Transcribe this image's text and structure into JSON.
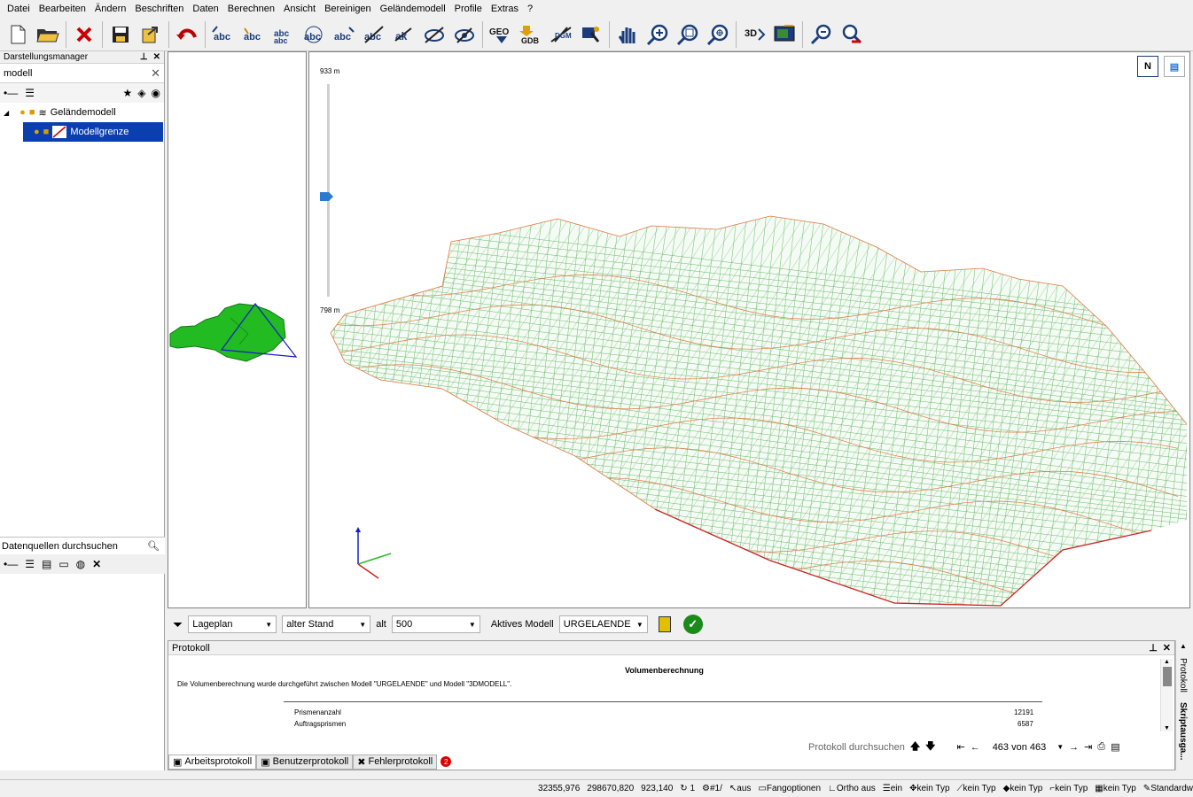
{
  "menu": [
    "Datei",
    "Bearbeiten",
    "Ändern",
    "Beschriften",
    "Daten",
    "Berechnen",
    "Ansicht",
    "Bereinigen",
    "Geländemodell",
    "Profile",
    "Extras",
    "?"
  ],
  "toolbar": {
    "icons": [
      "new-file-icon",
      "open-folder-icon",
      "close-icon",
      "save-icon",
      "export-icon",
      "undo-icon",
      "label-abc-icon",
      "label-abc-edit-icon",
      "label-abc-move-icon",
      "label-abc-rotate-icon",
      "label-abc-copy-icon",
      "label-abc-delete-icon",
      "label-ak-icon",
      "label-hide-icon",
      "label-show-icon",
      "geo-icon",
      "gdb-icon",
      "dgm-icon",
      "user-icon",
      "hand-pan-icon",
      "zoom-in-icon",
      "zoom-window-icon",
      "zoom-extent-icon",
      "view-3d-icon",
      "display-icon",
      "pick-icon",
      "search-erase-icon"
    ],
    "labels": {
      "geo": "GEO",
      "gdb": "GDB",
      "threed": "3D"
    }
  },
  "left_panel": {
    "title": "Darstellungsmanager",
    "search_value": "modell",
    "tree": {
      "root": "Geländemodell",
      "child": "Modellgrenze"
    }
  },
  "sources_panel": {
    "title": "Datenquellen durchsuchen"
  },
  "view3d": {
    "scale_top": "933 m",
    "scale_bottom": "798 m",
    "north_label": "N"
  },
  "filterbar": {
    "view_value": "Lageplan",
    "state_value": "alter Stand",
    "alt_label": "alt",
    "scale_value": "500",
    "active_model_label": "Aktives Modell",
    "active_model_value": "URGELAENDE"
  },
  "protokoll": {
    "title": "Protokoll",
    "heading": "Volumenberechnung",
    "text": "Die Volumenberechnung wurde durchgeführt zwischen Modell \"URGELAENDE\" und Modell \"3DMODELL\".",
    "rows": [
      {
        "label": "Prismenanzahl",
        "value": "12191"
      },
      {
        "label": "Auftragsprismen",
        "value": "6587"
      }
    ],
    "search_label": "Protokoll durchsuchen",
    "page_value": "463 von 463",
    "tabs": [
      "Arbeitsprotokoll",
      "Benutzerprotokoll",
      "Fehlerprotokoll"
    ],
    "error_badge": "2",
    "side_tabs": [
      "Protokoll",
      "Skriptausga..."
    ]
  },
  "status": {
    "coord_x": "32355,976",
    "coord_y": "298670,820",
    "coord_z": "923,140",
    "rotation": "1",
    "layer": "#1/",
    "snap": "aus",
    "snap_options": "Fangoptionen",
    "ortho": "Ortho aus",
    "grid": "ein",
    "type1": "kein Typ",
    "type2": "kein Typ",
    "type3": "kein Typ",
    "type4": "kein Typ",
    "type5": "kein Typ",
    "standard": "Standardw"
  },
  "colors": {
    "selection": "#0a3fb0",
    "mesh_light": "#6ab86a",
    "mesh_dark": "#1e6a1e",
    "contour": "#e07840",
    "green_shape": "#22bb22"
  }
}
